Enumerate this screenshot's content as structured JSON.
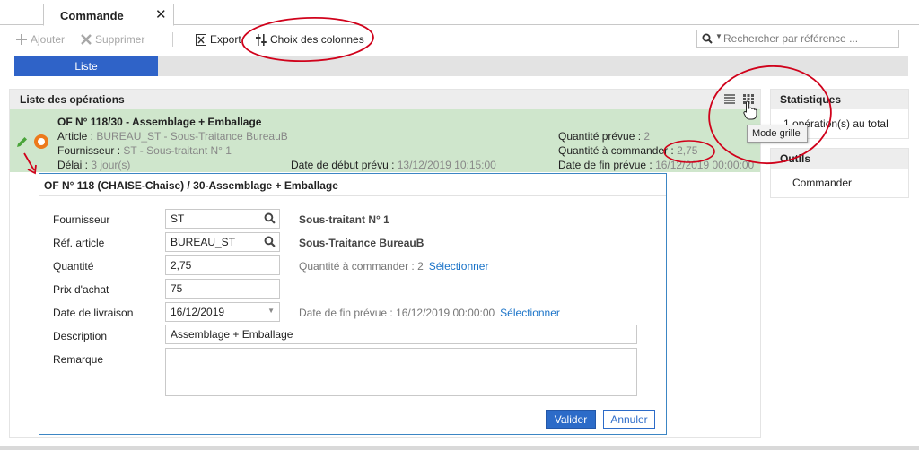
{
  "tabs": [
    {
      "label": "Commande",
      "close": "✕"
    }
  ],
  "toolbar": {
    "add_label": "Ajouter",
    "delete_label": "Supprimer",
    "export_label": "Export",
    "columns_label": "Choix des colonnes"
  },
  "search": {
    "placeholder": "Rechercher par référence ..."
  },
  "view_tabs": [
    {
      "label": "Liste"
    }
  ],
  "operations": {
    "title": "Liste des opérations",
    "row": {
      "title": "OF N° 118/30 - Assemblage + Emballage",
      "article_label": "Article : ",
      "article_value": "BUREAU_ST - Sous-Traitance BureauB",
      "supplier_label": "Fournisseur : ",
      "supplier_value": "ST - Sous-traitant N° 1",
      "delay_label": "Délai : ",
      "delay_value": "3 jour(s)",
      "start_label": "Date de début prévu : ",
      "start_value": "13/12/2019 10:15:00",
      "qty_planned_label": "Quantité prévue : ",
      "qty_planned_value": "2",
      "qty_order_label": "Quantité à commander : ",
      "qty_order_value": "2,75",
      "end_label": "Date de fin prévue : ",
      "end_value": "16/12/2019 00:00:00"
    }
  },
  "detail": {
    "title": "OF N° 118 (CHAISE-Chaise) / 30-Assemblage + Emballage",
    "fields": {
      "supplier": {
        "label": "Fournisseur",
        "value": "ST",
        "info": "Sous-traitant N° 1"
      },
      "article": {
        "label": "Réf. article",
        "value": "BUREAU_ST",
        "info": "Sous-Traitance BureauB"
      },
      "quantity": {
        "label": "Quantité",
        "value": "2,75",
        "hint": "Quantité à commander : 2",
        "link": "Sélectionner"
      },
      "price": {
        "label": "Prix d'achat",
        "value": "75"
      },
      "delivery": {
        "label": "Date de livraison",
        "value": "16/12/2019",
        "hint": "Date de fin prévue : 16/12/2019 00:00:00",
        "link": "Sélectionner"
      },
      "description": {
        "label": "Description",
        "value": "Assemblage + Emballage"
      },
      "remark": {
        "label": "Remarque",
        "value": ""
      }
    },
    "validate_label": "Valider",
    "cancel_label": "Annuler"
  },
  "sidebar": {
    "stats_title": "Statistiques",
    "stats_item": "1 opération(s) au total",
    "tools_title": "Outils",
    "tools_item": "Commander"
  },
  "tooltip": {
    "text": "Mode grille"
  },
  "colors": {
    "accent": "#2f63c8",
    "selected_row": "#cfe6cc",
    "status_orange": "#ec7a1c",
    "annotation_red": "#d0021b"
  }
}
